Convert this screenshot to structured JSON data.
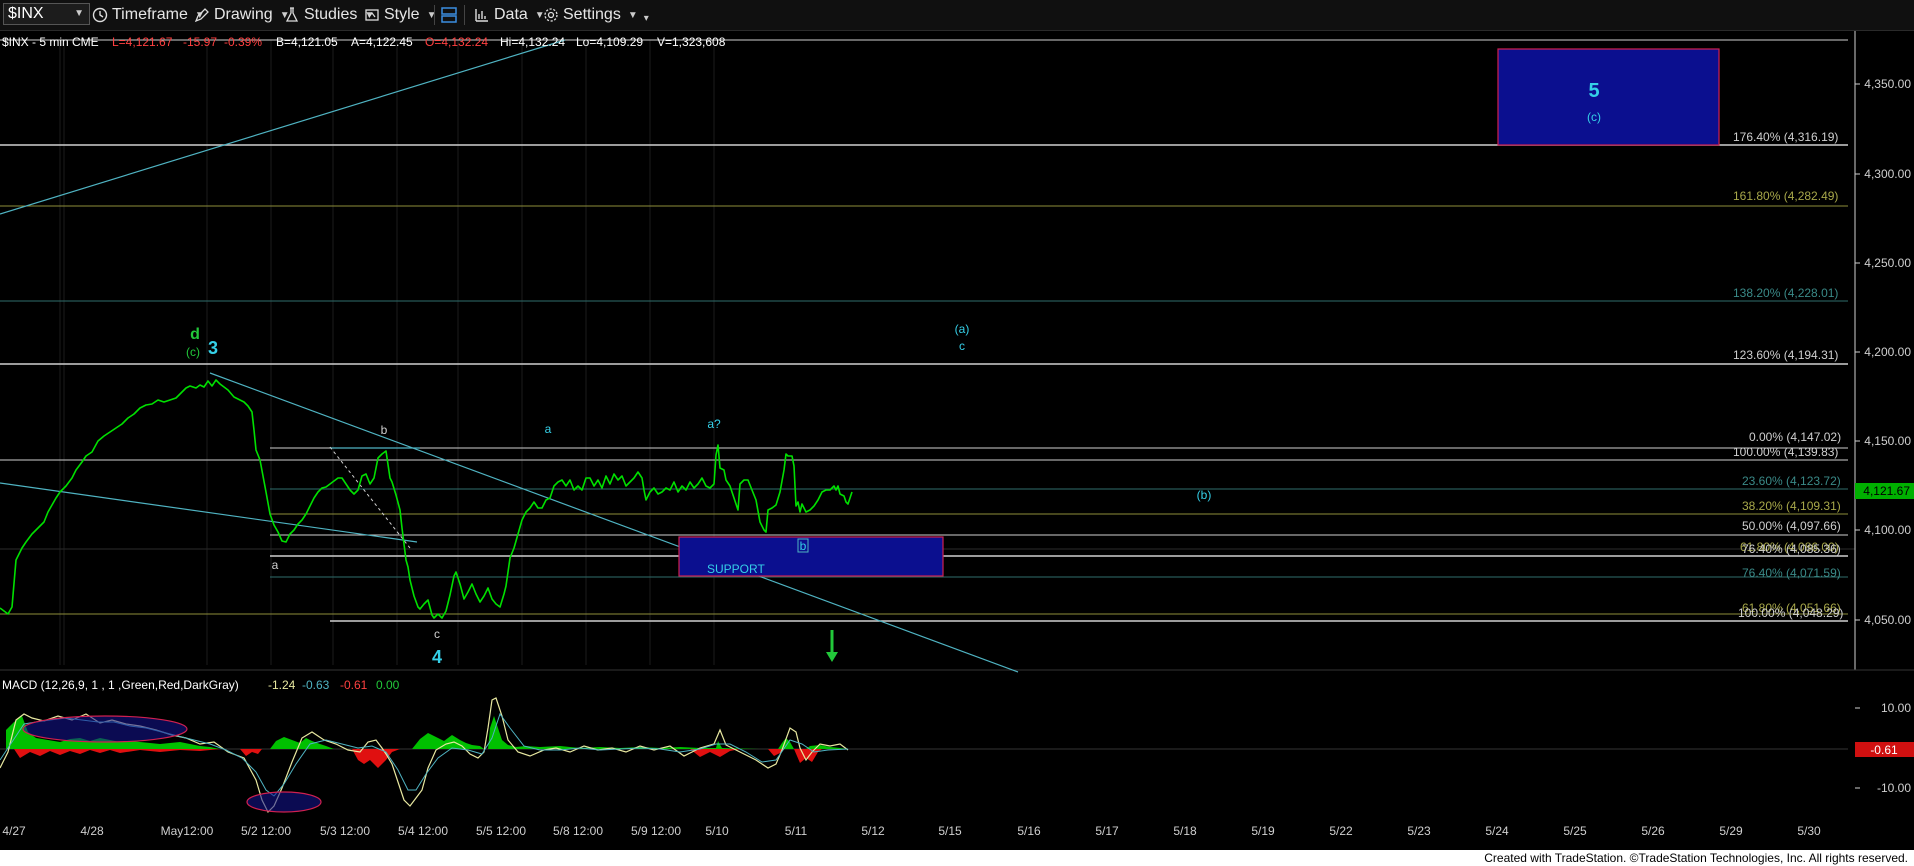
{
  "toolbar": {
    "symbol": "$INX",
    "timeframe": "Timeframe",
    "drawing": "Drawing",
    "studies": "Studies",
    "style": "Style",
    "data": "Data",
    "settings": "Settings"
  },
  "header": {
    "symbol_line": "$INX - 5 min  CME",
    "last": "L=4,121.67",
    "change": "-15.97",
    "pct": "-0.39%",
    "bid": "B=4,121.05",
    "ask": "A=4,122.45",
    "open": "O=4,132.24",
    "high": "Hi=4,132.24",
    "low": "Lo=4,109.29",
    "volume": "V=1,323,608"
  },
  "fib_levels": [
    {
      "label": "176.40% (4,316.19)",
      "value": 4316.19,
      "color": "#cfcfcf"
    },
    {
      "label": "161.80% (4,282.49)",
      "value": 4282.49,
      "color": "#a8a84a"
    },
    {
      "label": "138.20% (4,228.01)",
      "value": 4228.01,
      "color": "#3a8a88"
    },
    {
      "label": "123.60% (4,194.31)",
      "value": 4194.31,
      "color": "#cfcfcf"
    },
    {
      "label": "0.00% (4,147.02)",
      "value": 4147.02,
      "color": "#cfcfcf"
    },
    {
      "label": "100.00% (4,139.83)",
      "value": 4139.83,
      "color": "#cfcfcf"
    },
    {
      "label": "23.60% (4,123.72)",
      "value": 4123.72,
      "color": "#3a8a88"
    },
    {
      "label": "38.20% (4,109.31)",
      "value": 4109.31,
      "color": "#a8a84a"
    },
    {
      "label": "50.00% (4,097.66)",
      "value": 4097.66,
      "color": "#cfcfcf"
    },
    {
      "label": "61.80% (4,086.00)",
      "value": 4086.0,
      "color": "#a8a84a"
    },
    {
      "label": "76.40% (4,085.36)",
      "value": 4085.36,
      "color": "#cfcfcf"
    },
    {
      "label": "76.40% (4,071.59)",
      "value": 4071.59,
      "color": "#3a8a88"
    },
    {
      "label": "61.80% (4,051.66)",
      "value": 4051.66,
      "color": "#a8a84a"
    },
    {
      "label": "100.00% (4,048.29)",
      "value": 4048.29,
      "color": "#cfcfcf"
    }
  ],
  "price_axis": {
    "ticks": [
      "4,350.00",
      "4,300.00",
      "4,250.00",
      "4,200.00",
      "4,150.00",
      "4,100.00",
      "4,050.00"
    ],
    "last_price": "4,121.67"
  },
  "macd": {
    "label": "MACD (12,26,9, 1 , 1 ,Green,Red,DarkGray)",
    "v1": "-1.24",
    "v2": "-0.63",
    "v3": "-0.61",
    "v4": "0.00",
    "axis_ticks": [
      "10.00",
      "-10.00"
    ],
    "last_value": "-0.61"
  },
  "time_axis": [
    "4/27",
    "4/28",
    "May12:00",
    "5/2 12:00",
    "5/3 12:00",
    "5/4 12:00",
    "5/5 12:00",
    "5/8 12:00",
    "5/9 12:00",
    "5/10",
    "5/11",
    "5/12",
    "5/15",
    "5/16",
    "5/17",
    "5/18",
    "5/19",
    "5/22",
    "5/23",
    "5/24",
    "5/25",
    "5/26",
    "5/29",
    "5/30"
  ],
  "wave_labels": {
    "d": "d",
    "c_paren": "(c)",
    "three": "3",
    "a1": "a",
    "b1": "b",
    "c1": "c",
    "four": "4",
    "a2": "a",
    "a_q": "a?",
    "b_box": "b",
    "a_paren": "(a)",
    "c2": "c",
    "b_paren": "(b)",
    "five": "5",
    "c_paren2": "(c)"
  },
  "support_label": "SUPPORT",
  "footer": "Created with TradeStation. ©TradeStation Technologies, Inc. All rights reserved.",
  "colors": {
    "price": "#00e000",
    "fib_white": "#cfcfcf",
    "fib_olive": "#a8a84a",
    "fib_teal": "#3a8a88",
    "wave_cyan": "#35d0e8",
    "wave_green": "#22c83a",
    "box_fill": "#0b0f8f",
    "box_border": "#d02050"
  }
}
